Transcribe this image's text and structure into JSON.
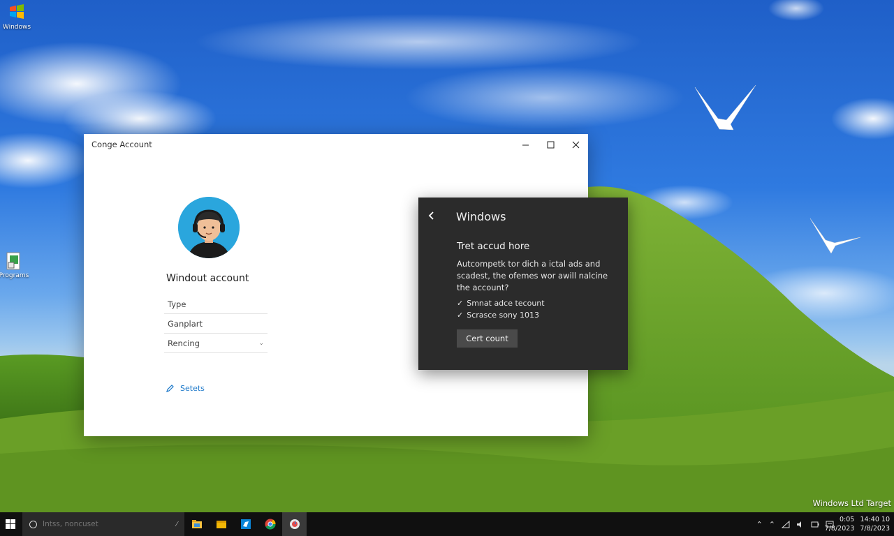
{
  "desktop": {
    "icons": [
      {
        "label": "Windows"
      },
      {
        "label": "Programs"
      }
    ],
    "watermark": "Windows Ltd Target"
  },
  "window": {
    "title": "Conge Account",
    "controls": {
      "minimize": "—",
      "maximize": "☐",
      "close": "✕"
    },
    "account_name": "Windout account",
    "fields": [
      {
        "label": "Type"
      },
      {
        "label": "Ganplart"
      },
      {
        "label": "Rencing"
      }
    ],
    "settings_link": "Setets"
  },
  "flyout": {
    "back": "‹",
    "title": "Windows",
    "heading": "Tret accud hore",
    "description": "Autcompetk tor dich a ictal ads and scadest, the ofemes wor awill nalcine the account?",
    "checks": [
      {
        "mark": "✓",
        "label": "Smnat adce tecount"
      },
      {
        "mark": "✓",
        "label": "Scrasce sony 1013"
      }
    ],
    "button_label": "Cert count"
  },
  "taskbar": {
    "search_placeholder": "Intss, noncuset",
    "apps": [
      "file-explorer-icon",
      "folder-icon",
      "store-icon",
      "chrome-icon",
      "app-icon"
    ],
    "tray_icons": [
      "chevron-up-icon",
      "chevron-up-icon",
      "network-icon",
      "volume-icon",
      "battery-icon",
      "notification-icon"
    ],
    "clock_time": "0:05",
    "clock_date": "7/8/2023",
    "clock_right_top": "14:40 10",
    "clock_right_bottom": "7/8/2023"
  }
}
